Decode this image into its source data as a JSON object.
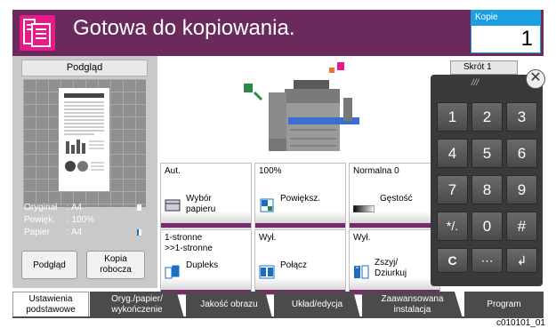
{
  "header": {
    "status": "Gotowa do kopiowania.",
    "copies_label": "Kopie",
    "copies_value": "1",
    "bg_color": "#6b2a5c",
    "icon": "copy-app-icon"
  },
  "preview": {
    "title": "Podgląd",
    "doc_heading": "Day Meeting Extra Rates",
    "rows": [
      {
        "label": "Oryginał",
        "value": ": A4"
      },
      {
        "label": "Powięk.",
        "value": ": 100%"
      },
      {
        "label": "Papier",
        "value": ": A4"
      }
    ],
    "preview_button": "Podgląd",
    "draft_button": "Kopia\nrobocza"
  },
  "shortcut": {
    "label": "Skrót 1"
  },
  "keypad": {
    "grip": "///",
    "keys": [
      "1",
      "2",
      "3",
      "4",
      "5",
      "6",
      "7",
      "8",
      "9",
      "*/.",
      "0",
      "#",
      "C",
      "⋯",
      "↲"
    ]
  },
  "functions": [
    {
      "value": "Aut.",
      "label": "Wybór\npapieru",
      "icon": "paper-select-icon"
    },
    {
      "value": "100%",
      "label": "Powiększ.",
      "icon": "zoom-icon"
    },
    {
      "value": "Normalna 0",
      "label": "Gęstość",
      "icon": "density-icon"
    },
    {
      "value": "1-stronne\n>>1-stronne",
      "label": "Dupleks",
      "icon": "duplex-icon"
    },
    {
      "value": "Wył.",
      "label": "Połącz",
      "icon": "combine-icon"
    },
    {
      "value": "Wył.",
      "label": "Zszyj/\nDziurkuj",
      "icon": "staple-punch-icon"
    }
  ],
  "tabs": [
    {
      "label": "Ustawienia\npodstawowe",
      "active": true
    },
    {
      "label": "Oryg./papier/\nwykończenie"
    },
    {
      "label": "Jakość obrazu"
    },
    {
      "label": "Układ/edycja"
    },
    {
      "label": "Zaawansowana\ninstalacja"
    },
    {
      "label": "Program"
    }
  ],
  "figure_code": "c010101_01"
}
